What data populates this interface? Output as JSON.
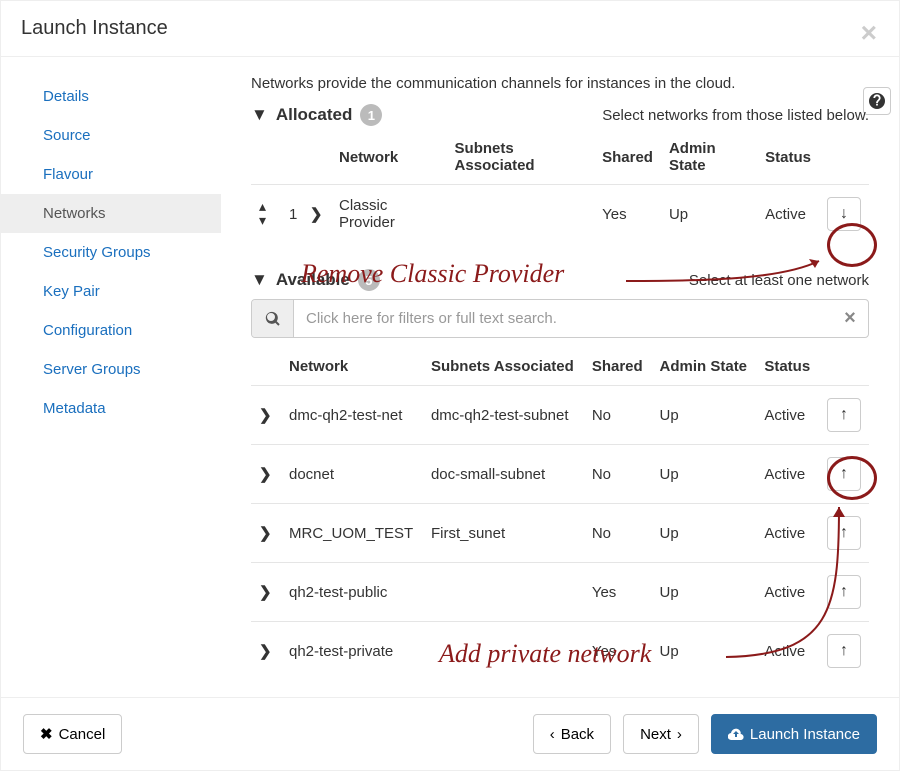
{
  "modal": {
    "title": "Launch Instance"
  },
  "sidebar": {
    "items": [
      {
        "label": "Details",
        "active": false
      },
      {
        "label": "Source",
        "active": false
      },
      {
        "label": "Flavour",
        "active": false
      },
      {
        "label": "Networks",
        "active": true
      },
      {
        "label": "Security Groups",
        "active": false
      },
      {
        "label": "Key Pair",
        "active": false
      },
      {
        "label": "Configuration",
        "active": false
      },
      {
        "label": "Server Groups",
        "active": false
      },
      {
        "label": "Metadata",
        "active": false
      }
    ]
  },
  "intro": "Networks provide the communication channels for instances in the cloud.",
  "allocated": {
    "title": "Allocated",
    "count": "1",
    "hint": "Select networks from those listed below.",
    "headers": {
      "network": "Network",
      "subnets": "Subnets Associated",
      "shared": "Shared",
      "admin": "Admin State",
      "status": "Status"
    },
    "rows": [
      {
        "order": "1",
        "name": "Classic Provider",
        "subnets": "",
        "shared": "Yes",
        "admin": "Up",
        "status": "Active"
      }
    ]
  },
  "available": {
    "title": "Available",
    "count": "5",
    "hint": "Select at least one network",
    "filter_placeholder": "Click here for filters or full text search.",
    "headers": {
      "network": "Network",
      "subnets": "Subnets Associated",
      "shared": "Shared",
      "admin": "Admin State",
      "status": "Status"
    },
    "rows": [
      {
        "name": "dmc-qh2-test-net",
        "subnets": "dmc-qh2-test-subnet",
        "shared": "No",
        "admin": "Up",
        "status": "Active"
      },
      {
        "name": "docnet",
        "subnets": "doc-small-subnet",
        "shared": "No",
        "admin": "Up",
        "status": "Active"
      },
      {
        "name": "MRC_UOM_TEST",
        "subnets": "First_sunet",
        "shared": "No",
        "admin": "Up",
        "status": "Active"
      },
      {
        "name": "qh2-test-public",
        "subnets": "",
        "shared": "Yes",
        "admin": "Up",
        "status": "Active"
      },
      {
        "name": "qh2-test-private",
        "subnets": "",
        "shared": "Yes",
        "admin": "Up",
        "status": "Active"
      }
    ]
  },
  "footer": {
    "cancel": "Cancel",
    "back": "Back",
    "next": "Next",
    "launch": "Launch Instance"
  },
  "annotations": {
    "remove": "Remove Classic Provider",
    "add": "Add private network"
  }
}
